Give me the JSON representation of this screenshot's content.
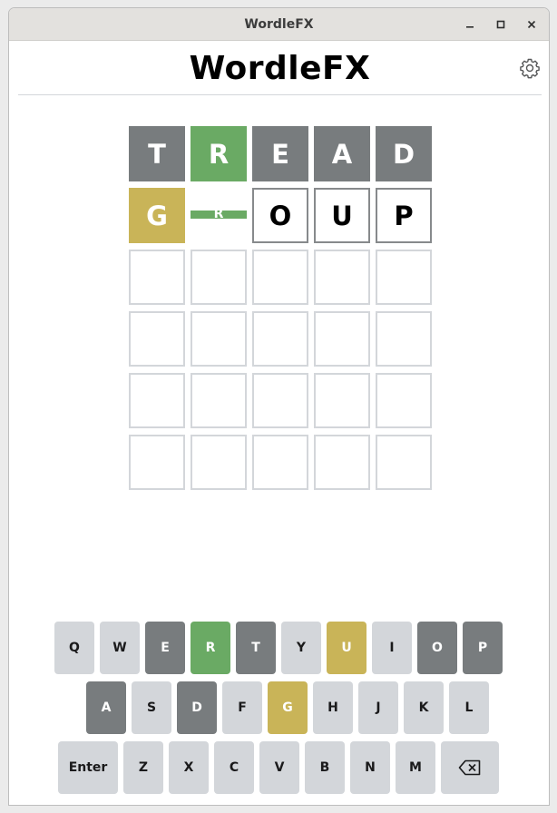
{
  "window": {
    "title": "WordleFX"
  },
  "header": {
    "title": "WordleFX",
    "settings_icon": "gear-icon"
  },
  "board": {
    "rows": [
      [
        {
          "letter": "T",
          "state": "absent"
        },
        {
          "letter": "R",
          "state": "correct"
        },
        {
          "letter": "E",
          "state": "absent"
        },
        {
          "letter": "A",
          "state": "absent"
        },
        {
          "letter": "D",
          "state": "absent"
        }
      ],
      [
        {
          "letter": "G",
          "state": "present"
        },
        {
          "letter": "R",
          "state": "flipping"
        },
        {
          "letter": "O",
          "state": "filled"
        },
        {
          "letter": "U",
          "state": "filled"
        },
        {
          "letter": "P",
          "state": "filled"
        }
      ],
      [
        {
          "letter": "",
          "state": "empty"
        },
        {
          "letter": "",
          "state": "empty"
        },
        {
          "letter": "",
          "state": "empty"
        },
        {
          "letter": "",
          "state": "empty"
        },
        {
          "letter": "",
          "state": "empty"
        }
      ],
      [
        {
          "letter": "",
          "state": "empty"
        },
        {
          "letter": "",
          "state": "empty"
        },
        {
          "letter": "",
          "state": "empty"
        },
        {
          "letter": "",
          "state": "empty"
        },
        {
          "letter": "",
          "state": "empty"
        }
      ],
      [
        {
          "letter": "",
          "state": "empty"
        },
        {
          "letter": "",
          "state": "empty"
        },
        {
          "letter": "",
          "state": "empty"
        },
        {
          "letter": "",
          "state": "empty"
        },
        {
          "letter": "",
          "state": "empty"
        }
      ],
      [
        {
          "letter": "",
          "state": "empty"
        },
        {
          "letter": "",
          "state": "empty"
        },
        {
          "letter": "",
          "state": "empty"
        },
        {
          "letter": "",
          "state": "empty"
        },
        {
          "letter": "",
          "state": "empty"
        }
      ]
    ]
  },
  "keyboard": {
    "rows": [
      [
        {
          "label": "Q",
          "state": "unused"
        },
        {
          "label": "W",
          "state": "unused"
        },
        {
          "label": "E",
          "state": "absent"
        },
        {
          "label": "R",
          "state": "correct"
        },
        {
          "label": "T",
          "state": "absent"
        },
        {
          "label": "Y",
          "state": "unused"
        },
        {
          "label": "U",
          "state": "present"
        },
        {
          "label": "I",
          "state": "unused"
        },
        {
          "label": "O",
          "state": "absent"
        },
        {
          "label": "P",
          "state": "absent"
        }
      ],
      [
        {
          "label": "A",
          "state": "absent"
        },
        {
          "label": "S",
          "state": "unused"
        },
        {
          "label": "D",
          "state": "absent"
        },
        {
          "label": "F",
          "state": "unused"
        },
        {
          "label": "G",
          "state": "present"
        },
        {
          "label": "H",
          "state": "unused"
        },
        {
          "label": "J",
          "state": "unused"
        },
        {
          "label": "K",
          "state": "unused"
        },
        {
          "label": "L",
          "state": "unused"
        }
      ],
      [
        {
          "label": "Enter",
          "state": "unused"
        },
        {
          "label": "Z",
          "state": "unused"
        },
        {
          "label": "X",
          "state": "unused"
        },
        {
          "label": "C",
          "state": "unused"
        },
        {
          "label": "V",
          "state": "unused"
        },
        {
          "label": "B",
          "state": "unused"
        },
        {
          "label": "N",
          "state": "unused"
        },
        {
          "label": "M",
          "state": "unused"
        },
        {
          "label": "",
          "icon": "backspace-icon",
          "state": "unused"
        }
      ]
    ]
  },
  "colors": {
    "absent": "#787c7e",
    "present": "#c9b458",
    "correct": "#6aaa64",
    "key_default": "#d3d6da",
    "tile_border": "#d3d6da"
  }
}
